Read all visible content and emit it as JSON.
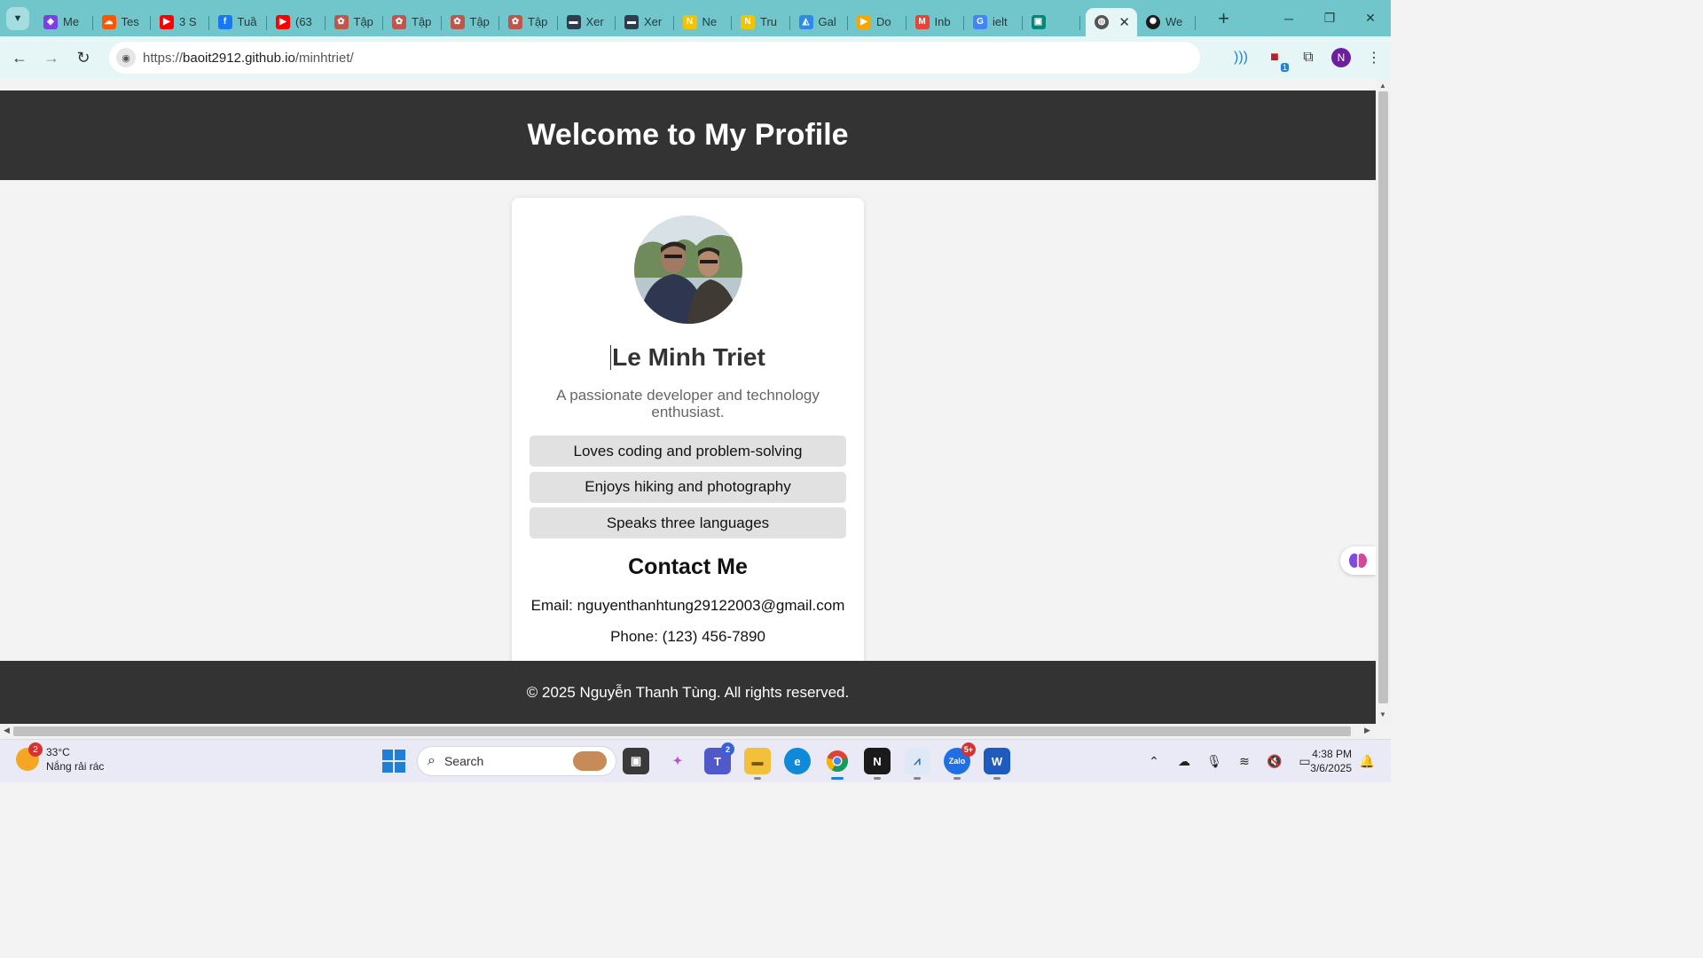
{
  "browser": {
    "tabs": [
      {
        "label": "Me",
        "icon": "messenger-icon",
        "color": "#7b3fe4"
      },
      {
        "label": "Tes",
        "icon": "soundcloud-icon",
        "color": "#ff5500"
      },
      {
        "label": "3 S",
        "icon": "youtube-icon",
        "color": "#ff0000"
      },
      {
        "label": "Tuầ",
        "icon": "facebook-icon",
        "color": "#1877f2"
      },
      {
        "label": "(63",
        "icon": "youtube-icon",
        "color": "#ff0000"
      },
      {
        "label": "Tập",
        "icon": "anime-site-icon",
        "color": "#c0564b"
      },
      {
        "label": "Tập",
        "icon": "anime-site-icon",
        "color": "#c0564b"
      },
      {
        "label": "Tập",
        "icon": "anime-site-icon",
        "color": "#c0564b"
      },
      {
        "label": "Tập",
        "icon": "anime-site-icon",
        "color": "#c0564b"
      },
      {
        "label": "Xer",
        "icon": "film-site-icon",
        "color": "#2c3e50"
      },
      {
        "label": "Xer",
        "icon": "film-site-icon",
        "color": "#2c3e50"
      },
      {
        "label": "Ne",
        "icon": "norton-icon",
        "color": "#f4c300"
      },
      {
        "label": "Tru",
        "icon": "norton-icon",
        "color": "#f4c300"
      },
      {
        "label": "Gal",
        "icon": "gallery-icon",
        "color": "#2b8be6"
      },
      {
        "label": "Do",
        "icon": "play-icon",
        "color": "#f7a600"
      },
      {
        "label": "Inb",
        "icon": "gmail-icon",
        "color": "#ea4335"
      },
      {
        "label": "ielt",
        "icon": "google-icon",
        "color": "#4285f4"
      },
      {
        "label": "",
        "icon": "meet-icon",
        "color": "#00897b"
      }
    ],
    "active_tab": {
      "label": "",
      "icon": "globe-icon"
    },
    "last_tab": {
      "label": "We",
      "icon": "chatgpt-icon"
    },
    "url_scheme": "https://",
    "url_host": "baoit2912.github.io",
    "url_path": "/minhtriet/",
    "profile_initial": "N",
    "extension_badge": "1"
  },
  "page": {
    "header_title": "Welcome to My Profile",
    "name": "Le Minh Triet",
    "bio": "A passionate developer and technology enthusiast.",
    "facts": [
      "Loves coding and problem-solving",
      "Enjoys hiking and photography",
      "Speaks three languages"
    ],
    "contact_title": "Contact Me",
    "email_line": "Email: nguyenthanhtung29122003@gmail.com",
    "phone_line": "Phone: (123) 456-7890",
    "footer_text": "© 2025 Nguyễn Thanh Tùng. All rights reserved."
  },
  "taskbar": {
    "weather_temp": "33°C",
    "weather_desc": "Nắng rải rác",
    "weather_badge": "2",
    "search_label": "Search",
    "teams_badge": "2",
    "zalo_badge": "5+",
    "time": "4:38 PM",
    "date": "3/6/2025"
  }
}
